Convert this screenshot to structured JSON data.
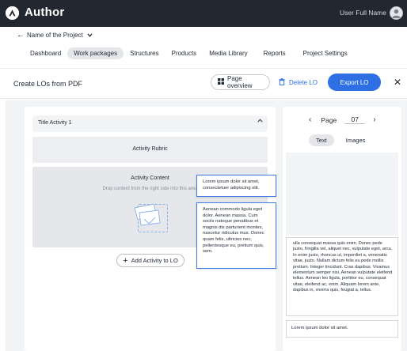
{
  "app": {
    "brand": "Author",
    "user_name": "User Full Name"
  },
  "project": {
    "name": "Name of the Project"
  },
  "nav": {
    "items": [
      {
        "label": "Dashboard",
        "active": false
      },
      {
        "label": "Work packages",
        "active": true
      },
      {
        "label": "Structures",
        "active": false
      },
      {
        "label": "Products",
        "active": false
      },
      {
        "label": "Media Library",
        "active": false
      },
      {
        "label": "Reports",
        "active": false
      },
      {
        "label": "Project Settings",
        "active": false
      }
    ]
  },
  "header": {
    "title": "Create LOs from PDF",
    "page_overview_label": "Page overview",
    "delete_label": "Delete LO",
    "export_label": "Export LO"
  },
  "activity": {
    "title": "Title Activity 1",
    "rubric_label": "Activity Rubric",
    "content_label": "Activity Content",
    "drop_hint": "Drop content from the right side into this area",
    "add_button_label": "Add Activity to LO"
  },
  "preview": {
    "page_label": "Page",
    "page_number": "07",
    "tabs": [
      {
        "label": "Text",
        "active": true
      },
      {
        "label": "Images",
        "active": false
      }
    ],
    "text_block_1": "ulla consequat massa quis enim. Donec pede justo, fringilla vel, aliquet nec, vulputate eget, arcu. In enim justo, rhoncus ut, imperdiet a, venenatis vitae, justo. Nullam dictum felis eu pede mollis pretium. Integer tincidunt. Cras dapibus. Vivamus elementum semper nisi. Aenean vulputate eleifend tellus. Aenean leo ligula, porttitor eu, consequat vitae, eleifend ac, enim. Aliquam lorem ante, dapibus in, viverra quis, feugiat a, tellus.",
    "text_block_2": "Lorem ipsum dolor sit amet."
  },
  "dragged_items": {
    "item_1": "Lorem ipsum dolor sit amet, consectetuer adipiscing elit.",
    "item_2": "Aenean commodo ligula eget dolor. Aenean massa. Cum sociis natoque penatibus et magnis dis parturient montes, nascetur ridiculus mus. Donec quam felis, ultricies nec, pellentesque eu, pretium quis, sem."
  },
  "colors": {
    "topbar": "#23272f",
    "accent": "#2f6fe4",
    "canvas": "#f3f4f6"
  }
}
